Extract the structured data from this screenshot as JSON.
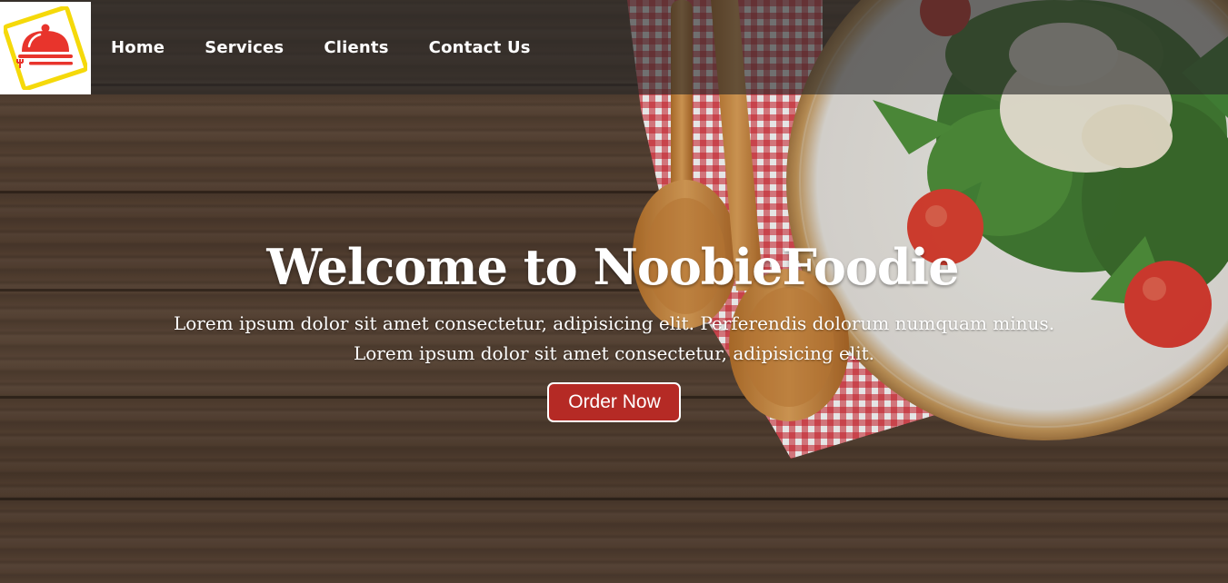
{
  "nav": {
    "logo_alt": "NoobieFoodie logo",
    "links": [
      "Home",
      "Services",
      "Clients",
      "Contact Us"
    ]
  },
  "hero": {
    "title": "Welcome to NoobieFoodie",
    "text_line1": "Lorem ipsum dolor sit amet consectetur, adipisicing elit. Perferendis dolorum numquam minus.",
    "text_line2": "Lorem ipsum dolor sit amet consectetur, adipisicing elit.",
    "button_label": "Order Now"
  },
  "colors": {
    "button_bg": "#b52a25",
    "logo_red": "#e8342c",
    "logo_frame": "#f5d90a",
    "navbar_overlay": "rgba(40,40,40,0.62)"
  },
  "icons": {
    "logo": "cloche-icon"
  }
}
